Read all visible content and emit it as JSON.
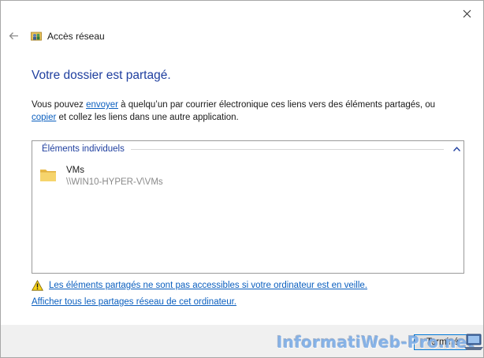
{
  "window": {
    "close_icon": "close-icon",
    "back_icon": "back-arrow-icon",
    "title": "Accès réseau",
    "title_icon": "network-access-icon"
  },
  "content": {
    "heading": "Votre dossier est partagé.",
    "para_part1": "Vous pouvez ",
    "para_link1": "envoyer",
    "para_part2": " à quelqu’un par courrier électronique ces liens vers des éléments partagés, ou ",
    "para_link2": "copier",
    "para_part3": " et collez les liens dans une autre application."
  },
  "group": {
    "header": "Éléments individuels",
    "collapse_icon": "chevron-up-icon",
    "items": [
      {
        "name": "VMs",
        "path": "\\\\WIN10-HYPER-V\\VMs",
        "icon": "folder-icon"
      }
    ]
  },
  "warning": {
    "icon": "warning-icon",
    "text": "Les éléments partagés ne sont pas accessibles si votre ordinateur est en veille."
  },
  "show_all_link": "Afficher tous les partages réseau de cet ordinateur.",
  "footer": {
    "finish_label": "Terminé"
  },
  "watermark": {
    "text": "InformatiWeb-Pro.net"
  }
}
